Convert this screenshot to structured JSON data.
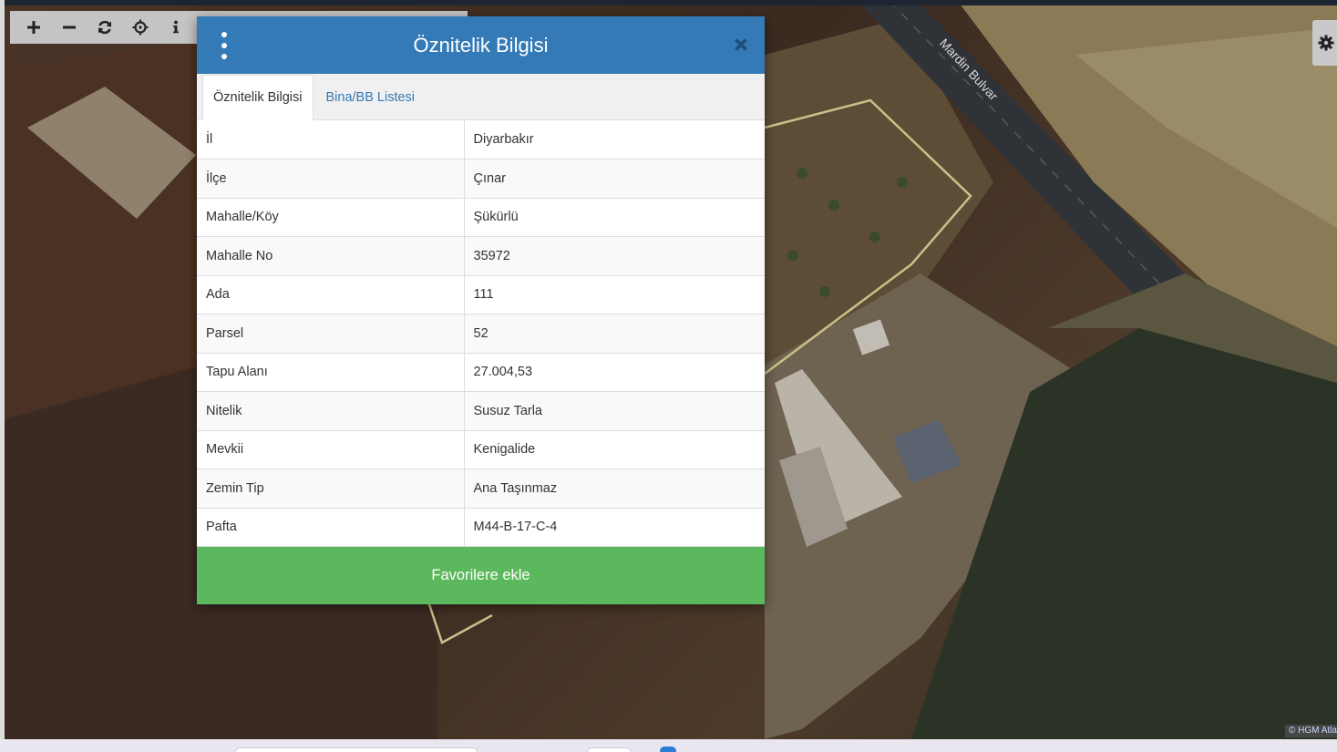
{
  "map": {
    "road_label": "Mardin Bulvar",
    "attribution": "© HGM Atlas",
    "colors": {
      "road": "#2f3338",
      "parcel_outline": "#c9c08a",
      "field_dark": "#2a3325",
      "field_light": "#8a7a55"
    }
  },
  "toolbar": {
    "buttons": [
      {
        "name": "zoom-in",
        "icon": "plus-icon"
      },
      {
        "name": "zoom-out",
        "icon": "minus-icon"
      },
      {
        "name": "refresh",
        "icon": "refresh-icon"
      },
      {
        "name": "locate",
        "icon": "crosshair-icon"
      },
      {
        "name": "info",
        "icon": "info-icon"
      }
    ]
  },
  "settings": {
    "icon": "gear-icon"
  },
  "dialog": {
    "title": "Öznitelik Bilgisi",
    "menu_icon": "vertical-dots-icon",
    "close_icon": "close-icon",
    "header_color": "#337ab7",
    "tabs": [
      {
        "label": "Öznitelik Bilgisi",
        "active": true
      },
      {
        "label": "Bina/BB Listesi",
        "active": false
      }
    ],
    "rows": [
      {
        "key": "İl",
        "value": "Diyarbakır"
      },
      {
        "key": "İlçe",
        "value": "Çınar"
      },
      {
        "key": "Mahalle/Köy",
        "value": "Şükürlü"
      },
      {
        "key": "Mahalle No",
        "value": "35972"
      },
      {
        "key": "Ada",
        "value": "111"
      },
      {
        "key": "Parsel",
        "value": "52"
      },
      {
        "key": "Tapu Alanı",
        "value": "27.004,53"
      },
      {
        "key": "Nitelik",
        "value": "Susuz Tarla"
      },
      {
        "key": "Mevkii",
        "value": "Kenigalide"
      },
      {
        "key": "Zemin Tip",
        "value": "Ana Taşınmaz"
      },
      {
        "key": "Pafta",
        "value": "M44-B-17-C-4"
      }
    ],
    "favorite_button": "Favorilere ekle",
    "favorite_color": "#5cb85c"
  }
}
